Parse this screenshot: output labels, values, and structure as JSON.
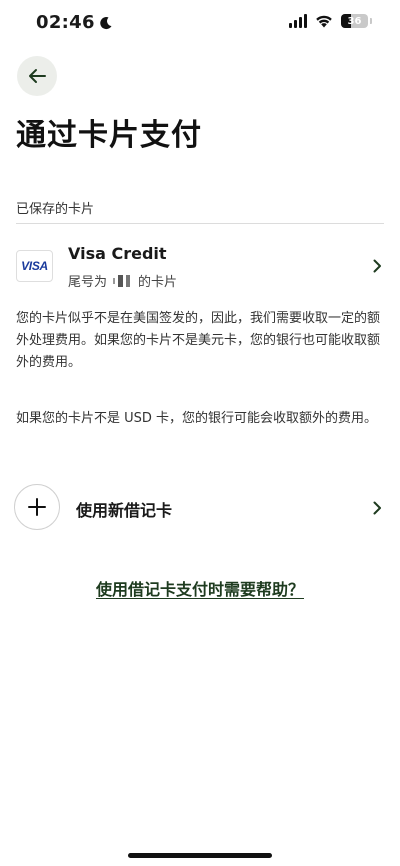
{
  "status_bar": {
    "time": "02:46",
    "battery_level": "36"
  },
  "header": {
    "title": "通过卡片支付"
  },
  "saved_cards": {
    "section_label": "已保存的卡片",
    "card": {
      "brand": "VISA",
      "name": "Visa Credit",
      "tail_prefix": "尾号为",
      "tail_suffix": "的卡片"
    }
  },
  "notices": {
    "foreign_fee": "您的卡片似乎不是在美国签发的，因此，我们需要收取一定的额外处理费用。如果您的卡片不是美元卡，您的银行也可能收取额外的费用。",
    "currency_fee": "如果您的卡片不是 USD 卡，您的银行可能会收取额外的费用。"
  },
  "add_card": {
    "label": "使用新借记卡"
  },
  "help": {
    "link_text": "使用借记卡支付时需要帮助？"
  },
  "icons": {
    "back": "arrow-left-icon",
    "chevron": "chevron-right-icon",
    "plus": "plus-icon",
    "moon": "moon-icon",
    "signal": "cellular-signal-icon",
    "wifi": "wifi-icon",
    "battery": "battery-icon"
  },
  "colors": {
    "accent_dark_green": "#1e3b1f",
    "back_button_bg": "#eceeea",
    "visa_blue": "#1a3a9c"
  }
}
